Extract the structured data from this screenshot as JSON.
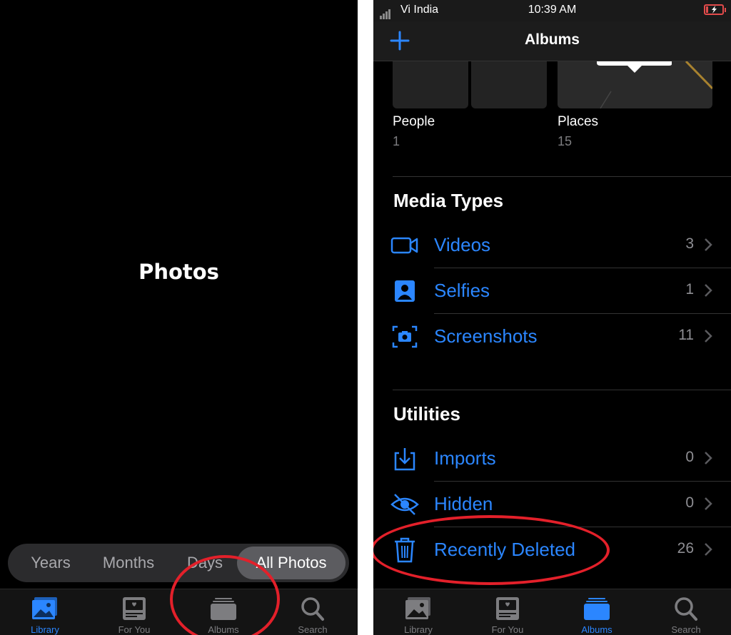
{
  "left": {
    "title": "Photos",
    "segments": [
      "Years",
      "Months",
      "Days",
      "All Photos"
    ],
    "active_segment": "All Photos",
    "tabs": [
      {
        "label": "Library",
        "icon": "photo-library-icon",
        "active": true
      },
      {
        "label": "For You",
        "icon": "for-you-icon",
        "active": false
      },
      {
        "label": "Albums",
        "icon": "albums-icon",
        "active": false
      },
      {
        "label": "Search",
        "icon": "search-icon",
        "active": false
      }
    ]
  },
  "right": {
    "status": {
      "carrier": "Vi India",
      "time": "10:39 AM"
    },
    "nav": {
      "title": "Albums",
      "add_icon": "plus-icon"
    },
    "people_places": [
      {
        "label": "People",
        "count": "1"
      },
      {
        "label": "Places",
        "count": "15"
      }
    ],
    "media_types": {
      "title": "Media Types",
      "items": [
        {
          "label": "Videos",
          "count": "3",
          "icon": "video-icon"
        },
        {
          "label": "Selfies",
          "count": "1",
          "icon": "selfie-icon"
        },
        {
          "label": "Screenshots",
          "count": "11",
          "icon": "screenshot-icon"
        }
      ]
    },
    "utilities": {
      "title": "Utilities",
      "items": [
        {
          "label": "Imports",
          "count": "0",
          "icon": "import-icon"
        },
        {
          "label": "Hidden",
          "count": "0",
          "icon": "hidden-eye-icon"
        },
        {
          "label": "Recently Deleted",
          "count": "26",
          "icon": "trash-icon"
        }
      ]
    },
    "tabs": [
      {
        "label": "Library",
        "icon": "photo-library-icon",
        "active": false
      },
      {
        "label": "For You",
        "icon": "for-you-icon",
        "active": false
      },
      {
        "label": "Albums",
        "icon": "albums-icon",
        "active": true
      },
      {
        "label": "Search",
        "icon": "search-icon",
        "active": false
      }
    ]
  },
  "colors": {
    "accent": "#2b86ff",
    "annotation": "#e3202a",
    "background": "#000000"
  }
}
